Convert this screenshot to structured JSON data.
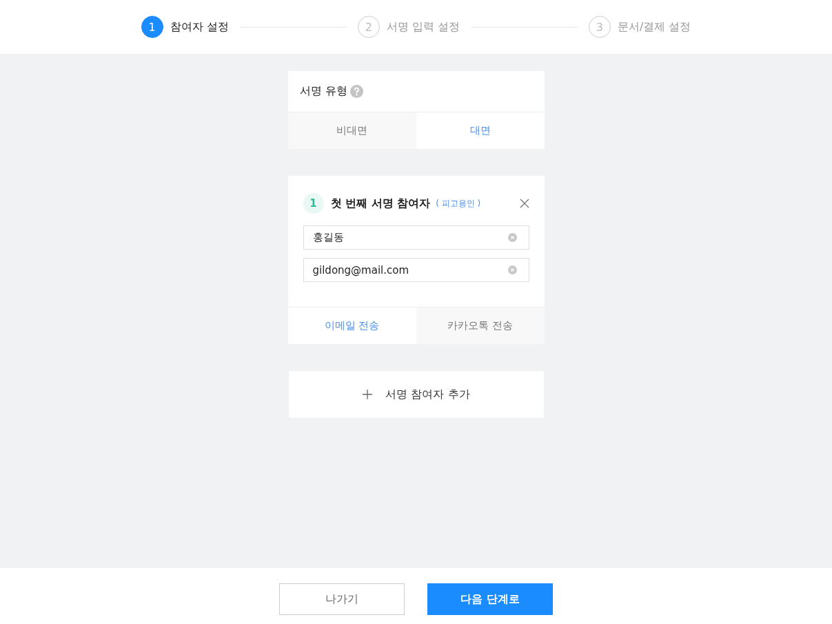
{
  "steps": [
    {
      "number": "1",
      "label": "참여자 설정",
      "selected": true
    },
    {
      "number": "2",
      "label": "서명 입력 설정",
      "selected": false
    },
    {
      "number": "3",
      "label": "문서/결제 설정",
      "selected": false
    }
  ],
  "sign_type": {
    "title": "서명 유형",
    "options": [
      {
        "label": "비대면",
        "selected": false
      },
      {
        "label": "대면",
        "selected": true
      }
    ]
  },
  "participants": [
    {
      "number": "1",
      "title": "첫 번째 서명 참여자",
      "role": "( 피고용인 )",
      "fields": [
        {
          "value": "홍길동"
        },
        {
          "value": "gildong@mail.com"
        }
      ],
      "send_options": [
        {
          "label": "이메일 전송",
          "selected": true
        },
        {
          "label": "카카오톡 전송",
          "selected": false
        }
      ]
    }
  ],
  "add_participant": {
    "label": "서명 참여자 추가"
  },
  "buttons": [
    {
      "label": "나가기",
      "kind": "secondary"
    },
    {
      "label": "다음 단계로",
      "kind": "primary"
    }
  ]
}
